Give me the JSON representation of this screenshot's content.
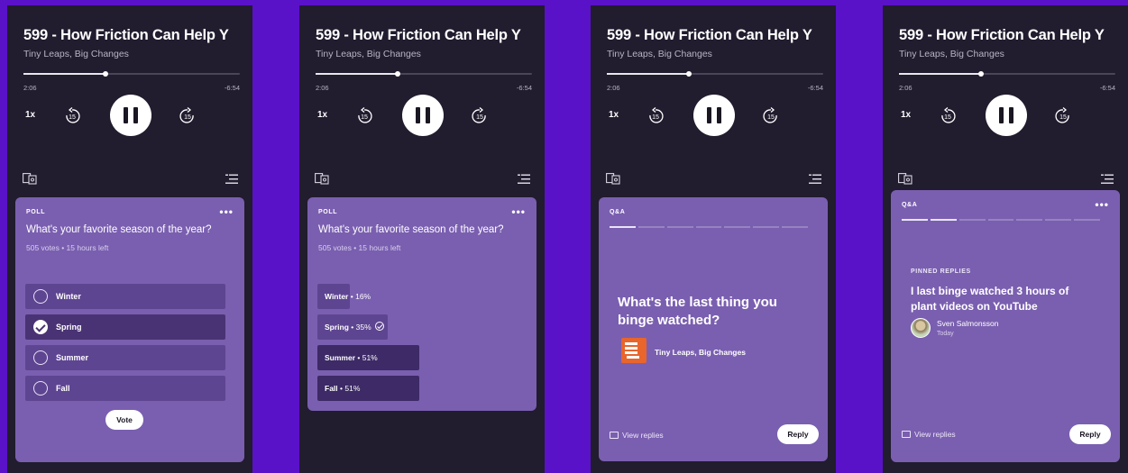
{
  "player": {
    "episode_title": "599 - How Friction Can Help Y",
    "show_name": "Tiny Leaps, Big Changes",
    "elapsed": "2:06",
    "remaining": "-6:54",
    "progress": 0.38,
    "speed": "1x",
    "skip_back_seconds": "15",
    "skip_forward_seconds": "15"
  },
  "poll": {
    "label": "POLL",
    "more": "•••",
    "question": "What's your favorite season of the year?",
    "meta": "505 votes • 15 hours left",
    "options": [
      {
        "label": "Winter",
        "selected": false
      },
      {
        "label": "Spring",
        "selected": true
      },
      {
        "label": "Summer",
        "selected": false
      },
      {
        "label": "Fall",
        "selected": false
      }
    ],
    "vote_label": "Vote"
  },
  "poll_results": {
    "label": "POLL",
    "more": "•••",
    "question": "What's your favorite season of the year?",
    "meta": "505 votes • 15 hours left",
    "results": [
      {
        "label": "Winter",
        "pct": "• 16%",
        "value": 16
      },
      {
        "label": "Spring",
        "pct": "• 35%",
        "value": 35,
        "voted": true
      },
      {
        "label": "Summer",
        "pct": "• 51%",
        "value": 51
      },
      {
        "label": "Fall",
        "pct": "• 51%",
        "value": 51
      }
    ]
  },
  "qa": {
    "label": "Q&A",
    "more": "•••",
    "question": "What's the last thing you binge watched?",
    "show_name": "Tiny Leaps, Big Changes",
    "view_replies": "View replies",
    "reply_label": "Reply"
  },
  "qa_reply": {
    "label": "Q&A",
    "more": "•••",
    "pinned_label": "PINNED REPLIES",
    "pinned_text": "I last binge watched 3 hours of plant videos on YouTube",
    "author": "Sven Salmonsson",
    "time": "Today",
    "view_replies": "View replies",
    "reply_label": "Reply"
  }
}
